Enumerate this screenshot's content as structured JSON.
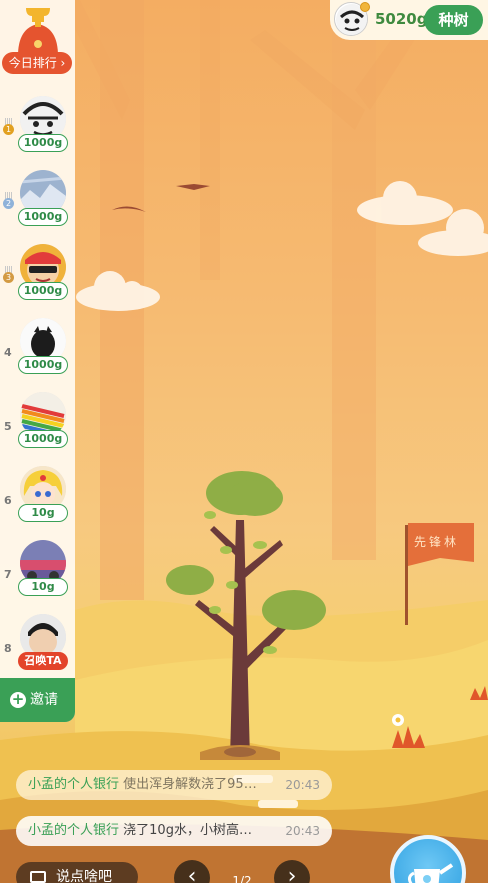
{
  "header": {
    "gram": "5020g",
    "plant_label": "种树"
  },
  "rank_panel": {
    "today_label": "今日排行 ›",
    "items": [
      {
        "rank": "1",
        "value": "1000g",
        "medal_color": "#e2a020"
      },
      {
        "rank": "2",
        "value": "1000g",
        "medal_color": "#8fb2d9"
      },
      {
        "rank": "3",
        "value": "1000g",
        "medal_color": "#d39a43"
      },
      {
        "rank": "4",
        "value": "1000g"
      },
      {
        "rank": "5",
        "value": "1000g"
      },
      {
        "rank": "6",
        "value": "10g"
      },
      {
        "rank": "7",
        "value": "10g"
      },
      {
        "rank": "8",
        "value": "召唤TA"
      }
    ],
    "invite_label": "邀请"
  },
  "flag_text": "先锋林",
  "messages": [
    {
      "nick": "小孟的个人银行",
      "text": "使出浑身解数浇了95…",
      "time": "20:43"
    },
    {
      "nick": "小孟的个人银行",
      "text": "浇了10g水，小树高…",
      "time": "20:43"
    }
  ],
  "bottom": {
    "chat_placeholder": "说点啥吧",
    "pager": "1/2"
  },
  "colors": {
    "accent_green": "#3aa056",
    "rank_red": "#e5542f"
  }
}
